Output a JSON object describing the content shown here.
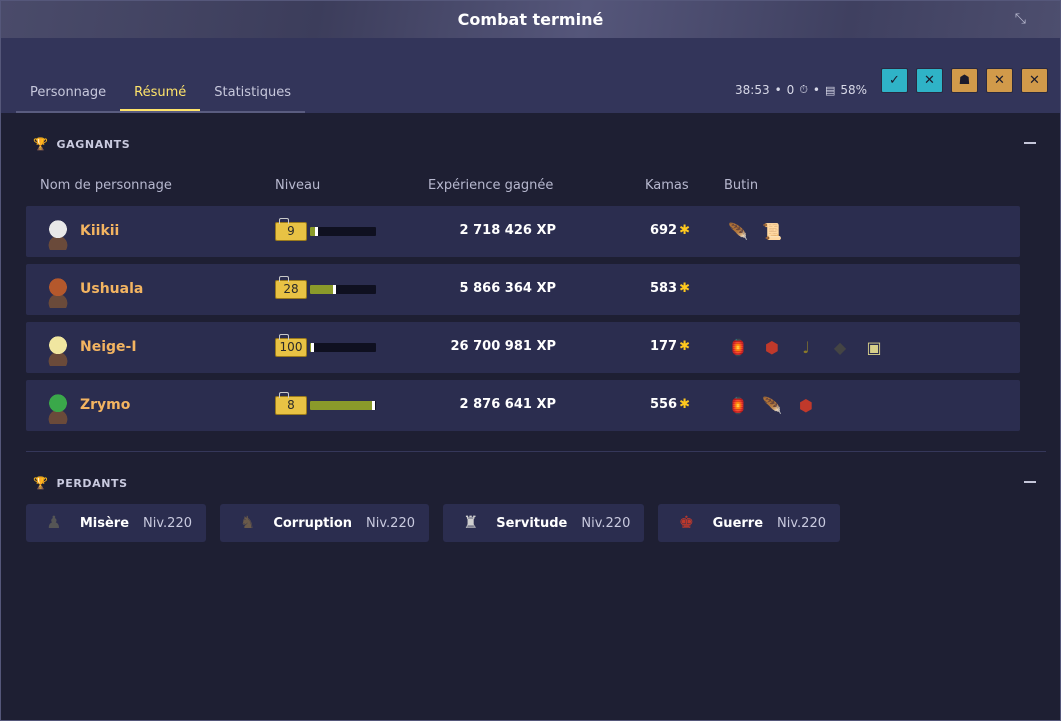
{
  "window": {
    "title": "Combat terminé"
  },
  "tabs": [
    {
      "label": "Personnage"
    },
    {
      "label": "Résumé"
    },
    {
      "label": "Statistiques"
    }
  ],
  "fight_info": {
    "duration": "38:53",
    "turns": "0",
    "sep": "•",
    "challenge_percent": "58%"
  },
  "header_icons": [
    {
      "name": "challenge-icon-1",
      "color": "#2fb3c7",
      "glyph": "✓"
    },
    {
      "name": "challenge-icon-2",
      "color": "#2fb3c7",
      "glyph": "✕"
    },
    {
      "name": "challenge-icon-3",
      "color": "#d19a4a",
      "glyph": "☗"
    },
    {
      "name": "challenge-icon-4",
      "color": "#d19a4a",
      "glyph": "✕"
    },
    {
      "name": "challenge-icon-5",
      "color": "#d19a4a",
      "glyph": "✕"
    }
  ],
  "winners": {
    "heading": "GAGNANTS",
    "columns": {
      "name": "Nom de personnage",
      "level": "Niveau",
      "xp": "Expérience gagnée",
      "kamas": "Kamas",
      "loot": "Butin"
    },
    "rows": [
      {
        "name": "Kiikii",
        "level": "9",
        "level_progress": 0.12,
        "xp": "2 718 426 XP",
        "kamas": "692",
        "loot": [
          "feather",
          "scroll"
        ]
      },
      {
        "name": "Ushuala",
        "level": "28",
        "level_progress": 0.4,
        "xp": "5 866 364 XP",
        "kamas": "583",
        "loot": []
      },
      {
        "name": "Neige-I",
        "level": "100",
        "level_progress": 0.06,
        "xp": "26 700 981 XP",
        "kamas": "177",
        "loot": [
          "lantern",
          "gem",
          "horn",
          "ore",
          "resource"
        ]
      },
      {
        "name": "Zrymo",
        "level": "8",
        "level_progress": 0.98,
        "xp": "2 876 641 XP",
        "kamas": "556",
        "loot": [
          "lantern",
          "feather",
          "gem"
        ]
      }
    ]
  },
  "losers": {
    "heading": "PERDANTS",
    "items": [
      {
        "name": "Misère",
        "level": "Niv.220"
      },
      {
        "name": "Corruption",
        "level": "Niv.220"
      },
      {
        "name": "Servitude",
        "level": "Niv.220"
      },
      {
        "name": "Guerre",
        "level": "Niv.220"
      }
    ]
  },
  "colors": {
    "name_orange": "#f3b461",
    "level_gold": "#e8c244",
    "kamas_gold": "#ffc91e",
    "active_tab": "#ffe46a"
  }
}
